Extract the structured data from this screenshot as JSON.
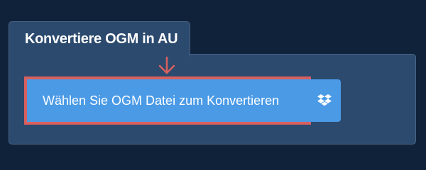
{
  "converter": {
    "tab_title": "Konvertiere OGM in AU",
    "upload_button_label": "Wählen Sie OGM Datei zum Konvertieren",
    "dropbox_icon": "dropbox-icon",
    "arrow_icon": "arrow-down-icon"
  },
  "colors": {
    "page_background": "#10213a",
    "panel_background": "#2c4a6e",
    "button_background": "#4a9ae6",
    "highlight_border": "#d9605f",
    "text": "#ffffff"
  }
}
